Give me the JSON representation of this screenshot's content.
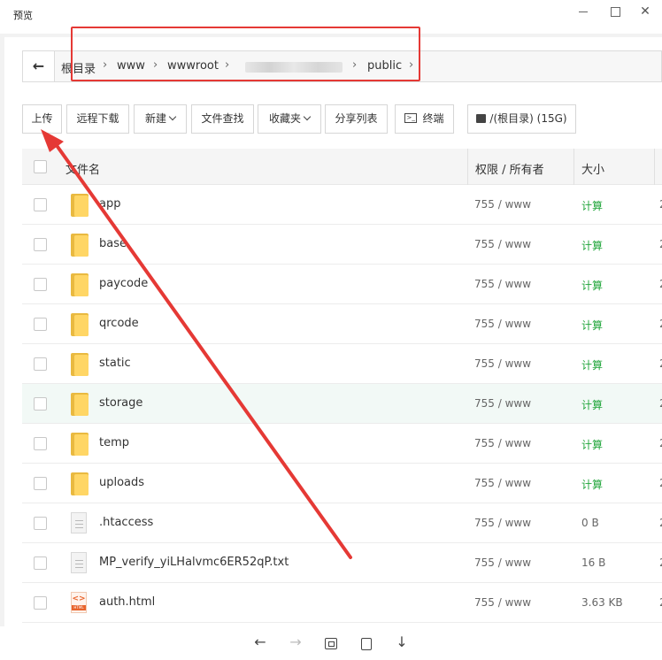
{
  "window": {
    "title": "预览"
  },
  "path": {
    "segments": [
      {
        "label": "根目录"
      },
      {
        "label": "www"
      },
      {
        "label": "wwwroot"
      },
      {
        "label": "public"
      }
    ]
  },
  "toolbar": {
    "upload": "上传",
    "remote_download": "远程下载",
    "new": "新建",
    "file_search": "文件查找",
    "favorites": "收藏夹",
    "share_list": "分享列表",
    "terminal": "终端",
    "disk": "/(根目录) (15G)"
  },
  "table": {
    "headers": {
      "name": "文件名",
      "perm": "权限 / 所有者",
      "size": "大小"
    },
    "rows": [
      {
        "name": "app",
        "type": "folder",
        "perm": "755 / www",
        "size": "计算",
        "extra": "2"
      },
      {
        "name": "base",
        "type": "folder",
        "perm": "755 / www",
        "size": "计算",
        "extra": "2"
      },
      {
        "name": "paycode",
        "type": "folder",
        "perm": "755 / www",
        "size": "计算",
        "extra": "2"
      },
      {
        "name": "qrcode",
        "type": "folder",
        "perm": "755 / www",
        "size": "计算",
        "extra": "2"
      },
      {
        "name": "static",
        "type": "folder",
        "perm": "755 / www",
        "size": "计算",
        "extra": "2"
      },
      {
        "name": "storage",
        "type": "folder",
        "perm": "755 / www",
        "size": "计算",
        "extra": "2"
      },
      {
        "name": "temp",
        "type": "folder",
        "perm": "755 / www",
        "size": "计算",
        "extra": "2"
      },
      {
        "name": "uploads",
        "type": "folder",
        "perm": "755 / www",
        "size": "计算",
        "extra": "2"
      },
      {
        "name": ".htaccess",
        "type": "file",
        "perm": "755 / www",
        "size": "0 B",
        "extra": "2"
      },
      {
        "name": "MP_verify_yiLHalvmc6ER52qP.txt",
        "type": "file",
        "perm": "755 / www",
        "size": "16 B",
        "extra": "2"
      },
      {
        "name": "auth.html",
        "type": "html",
        "perm": "755 / www",
        "size": "3.63 KB",
        "extra": "2"
      }
    ]
  },
  "icons": {
    "back": "arrow-left-icon",
    "folder": "folder-icon",
    "file": "text-file-icon",
    "html": "html-file-icon",
    "terminal": "terminal-icon",
    "disk": "disk-icon"
  },
  "colors": {
    "annotation_red": "#e53935",
    "calc_green": "#20a53a",
    "folder_yellow": "#ffd665",
    "row_highlight": "#f2f9f6"
  }
}
